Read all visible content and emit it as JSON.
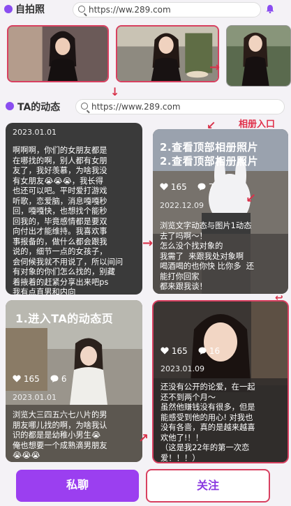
{
  "header": {
    "title": "自拍照",
    "url": "https://ww.289.com"
  },
  "feed": {
    "title": "TA的动态",
    "url": "https://www.289.com",
    "annotation_album": "相册入口"
  },
  "cards": {
    "c1": {
      "date": "2023.01.01",
      "text": "啊啊啊，你们的女朋友都是\n在哪找的啊，别人都有女朋\n友了，我好羡慕，为啥我没\n有女朋友😭😭😭，我长得\n也还可以吧。平时爱打游戏\n听歌，恋爱脑，消息嘎嘎秒\n回，嘎嘎快，也想找个能秒\n回我的，毕竟感情都是要双\n向付出才能维持。我喜欢事\n事报备的，做什么都会跟我\n说的，细节一点的女孩子，\n会伺候我就不用说了，所以间问\n有对象的你们怎么找的，别藏\n着掖着的赶紧分享出来吧ps\n我有点直男和内向"
    },
    "c2": {
      "caption1": "2.查看顶部相册照片",
      "caption2": "2.查看顶部相册照片",
      "likes": "165",
      "comments": "7",
      "date": "2022.12.09",
      "text": "浏览文字动态与图片1动态\n去了吗啊～！\n怎么没个找对象的\n我需了  来跟我处对象啊\n喝酒喝的也你快 比你多  还\n能打你回家\n都来跟我谈！"
    },
    "c3": {
      "caption": "1.进入TA的动态页",
      "likes": "165",
      "comments": "6",
      "date": "2023.01.01",
      "text": "浏览大三四五六七八片的男\n朋友哪儿找的啊，为啥我认\n识的都是是幼稚小男生😭\n俺也想要一个成熟滴男朋友\n😭😭😭"
    },
    "c4": {
      "likes": "165",
      "comments": "16",
      "date": "2023.01.09",
      "text": "还没有公开的论爱，在一起\n还不到两个月～\n虽然他赚钱没有很多，但是\n能感受到他的用心! 对我也\n没有各啬，真的是越来越喜\n欢他了!！！\n（这是我22年的第一次恋\n爱！！！）"
    }
  },
  "buttons": {
    "chat": "私聊",
    "follow": "关注"
  },
  "colors": {
    "accent": "#9b3ff0",
    "annotation_red": "#d8324a"
  }
}
